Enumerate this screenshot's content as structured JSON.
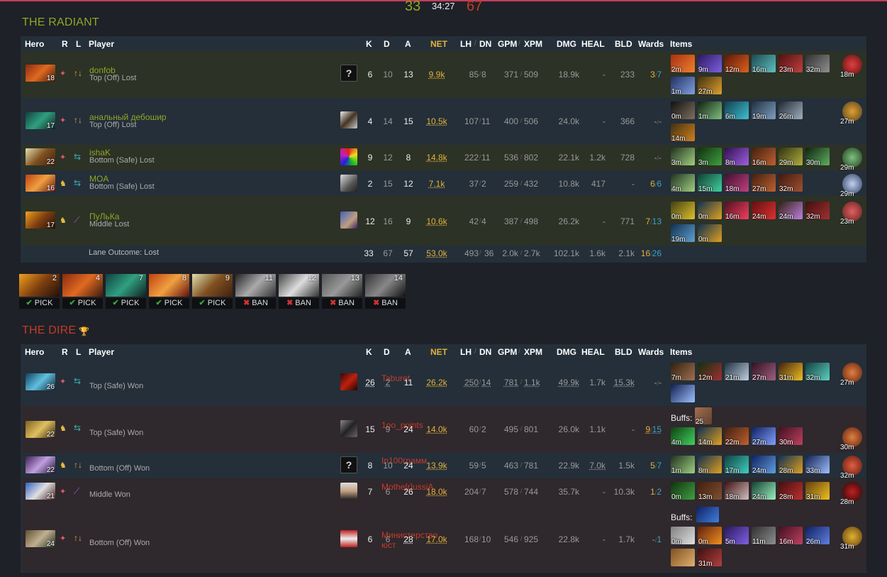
{
  "score": {
    "radiant": "33",
    "time": "34:27",
    "dire": "67"
  },
  "radiant": {
    "title": "THE RADIANT",
    "headers": {
      "hero": "Hero",
      "r": "R",
      "l": "L",
      "player": "Player",
      "k": "K",
      "d": "D",
      "a": "A",
      "net": "NET",
      "lh": "LH",
      "dn": "DN",
      "gpm": "GPM",
      "xpm": "XPM",
      "dmg": "DMG",
      "heal": "HEAL",
      "bld": "BLD",
      "wards": "Wards",
      "items": "Items"
    },
    "players": [
      {
        "level": "18",
        "name": "donfob",
        "lane": "Top (Off) Lost",
        "k": "6",
        "d": "10",
        "a": "13",
        "net": "9.9k",
        "lh": "85",
        "dn": "8",
        "gpm": "371",
        "xpm": "509",
        "dmg": "18.9k",
        "heal": "-",
        "bld": "233",
        "obs": "3",
        "sen": "7",
        "items": [
          "2m",
          "9m",
          "12m",
          "16m",
          "23m",
          "32m",
          "1m",
          "27m"
        ],
        "neutral": "18m"
      },
      {
        "level": "17",
        "name": "анальный дебошир",
        "lane": "Top (Off) Lost",
        "k": "4",
        "d": "14",
        "a": "15",
        "net": "10.5k",
        "lh": "107",
        "dn": "11",
        "gpm": "400",
        "xpm": "506",
        "dmg": "24.0k",
        "heal": "-",
        "bld": "366",
        "obs": "-",
        "sen": "-",
        "items": [
          "0m",
          "1m",
          "6m",
          "19m",
          "26m",
          "14m"
        ],
        "neutral": "27m"
      },
      {
        "level": "22",
        "name": "ishaK",
        "lane": "Bottom (Safe) Lost",
        "k": "9",
        "d": "12",
        "a": "8",
        "net": "14.8k",
        "lh": "222",
        "dn": "11",
        "gpm": "536",
        "xpm": "802",
        "dmg": "22.1k",
        "heal": "1.2k",
        "bld": "728",
        "obs": "-",
        "sen": "-",
        "items": [
          "3m",
          "3m",
          "8m",
          "16m",
          "29m",
          "30m"
        ],
        "neutral": "29m"
      },
      {
        "level": "16",
        "name": "MOA",
        "lane": "Bottom (Safe) Lost",
        "k": "2",
        "d": "15",
        "a": "12",
        "net": "7.1k",
        "lh": "37",
        "dn": "2",
        "gpm": "259",
        "xpm": "432",
        "dmg": "10.8k",
        "heal": "417",
        "bld": "-",
        "obs": "6",
        "sen": "6",
        "items": [
          "4m",
          "15m",
          "18m",
          "27m",
          "32m"
        ],
        "neutral": "29m"
      },
      {
        "level": "17",
        "name": "ПуЛьКа",
        "lane": "Middle Lost",
        "k": "12",
        "d": "16",
        "a": "9",
        "net": "10.6k",
        "lh": "42",
        "dn": "4",
        "gpm": "387",
        "xpm": "498",
        "dmg": "26.2k",
        "heal": "-",
        "bld": "771",
        "obs": "7",
        "sen": "13",
        "items": [
          "0m",
          "0m",
          "16m",
          "24m",
          "24m",
          "32m",
          "19m",
          "0m"
        ],
        "neutral": "23m"
      }
    ],
    "totals": {
      "label": "Lane Outcome: Lost",
      "k": "33",
      "d": "67",
      "a": "57",
      "net": "53.0k",
      "lh": "493",
      "dn": "36",
      "gpm": "2.0k",
      "xpm": "2.7k",
      "dmg": "102.1k",
      "heal": "1.6k",
      "bld": "2.1k",
      "obs": "16",
      "sen": "26"
    }
  },
  "draft": [
    {
      "num": "2",
      "label": "PICK",
      "type": "pick"
    },
    {
      "num": "4",
      "label": "PICK",
      "type": "pick"
    },
    {
      "num": "7",
      "label": "PICK",
      "type": "pick"
    },
    {
      "num": "8",
      "label": "PICK",
      "type": "pick"
    },
    {
      "num": "9",
      "label": "PICK",
      "type": "pick"
    },
    {
      "num": "11",
      "label": "BAN",
      "type": "ban"
    },
    {
      "num": "12",
      "label": "BAN",
      "type": "ban"
    },
    {
      "num": "13",
      "label": "BAN",
      "type": "ban"
    },
    {
      "num": "14",
      "label": "BAN",
      "type": "ban"
    }
  ],
  "dire": {
    "title": "THE DIRE",
    "headers": {
      "hero": "Hero",
      "r": "R",
      "l": "L",
      "player": "Player",
      "k": "K",
      "d": "D",
      "a": "A",
      "net": "NET",
      "lh": "LH",
      "dn": "DN",
      "gpm": "GPM",
      "xpm": "XPM",
      "dmg": "DMG",
      "heal": "HEAL",
      "bld": "BLD",
      "wards": "Wards",
      "items": "Items"
    },
    "buffs_label": "Buffs:",
    "players": [
      {
        "level": "26",
        "name": "Taburet",
        "lane": "Top (Safe) Won",
        "k": "26",
        "d": "2",
        "a": "11",
        "net": "26.2k",
        "lh": "250",
        "dn": "14",
        "gpm": "781",
        "xpm": "1.1k",
        "dmg": "49.9k",
        "heal": "1.7k",
        "bld": "15.3k",
        "obs": "-",
        "sen": "-",
        "items": [
          "7m",
          "12m",
          "21m",
          "27m",
          "31m",
          "32m",
          ""
        ],
        "neutral": "27m"
      },
      {
        "level": "22",
        "name": "1oo_points",
        "lane": "Top (Safe) Won",
        "k": "15",
        "d": "9",
        "a": "24",
        "net": "14.0k",
        "lh": "60",
        "dn": "2",
        "gpm": "495",
        "xpm": "801",
        "dmg": "26.0k",
        "heal": "1.1k",
        "bld": "-",
        "obs": "9",
        "sen": "15",
        "buff": "25",
        "items": [
          "4m",
          "14m",
          "22m",
          "27m",
          "30m"
        ],
        "neutral": "30m"
      },
      {
        "level": "22",
        "name": "In100грамм",
        "lane": "Bottom (Off) Won",
        "k": "8",
        "d": "10",
        "a": "24",
        "net": "13.9k",
        "lh": "59",
        "dn": "5",
        "gpm": "463",
        "xpm": "781",
        "dmg": "22.9k",
        "heal": "7.0k",
        "bld": "1.5k",
        "obs": "5",
        "sen": "7",
        "items": [
          "1m",
          "8m",
          "17m",
          "24m",
          "28m",
          "33m"
        ],
        "neutral": "32m"
      },
      {
        "level": "21",
        "name": "Mothe[r]ussiA",
        "lane": "Middle Won",
        "k": "7",
        "d": "6",
        "a": "26",
        "net": "18.0k",
        "lh": "204",
        "dn": "7",
        "gpm": "578",
        "xpm": "744",
        "dmg": "35.7k",
        "heal": "-",
        "bld": "10.3k",
        "obs": "1",
        "sen": "2",
        "items": [
          "0m",
          "13m",
          "18m",
          "24m",
          "28m",
          "31m"
        ],
        "neutral": "28m"
      },
      {
        "level": "24",
        "name": "Министерство юст",
        "lane": "Bottom (Off) Won",
        "k": "6",
        "d": "6",
        "a": "28",
        "net": "17.0k",
        "lh": "168",
        "dn": "10",
        "gpm": "546",
        "xpm": "925",
        "dmg": "22.8k",
        "heal": "-",
        "bld": "1.7k",
        "obs": "-",
        "sen": "1",
        "buff": "",
        "items": [
          "0m",
          "0m",
          "5m",
          "11m",
          "16m",
          "26m",
          "",
          "31m"
        ],
        "neutral": "31m"
      }
    ]
  }
}
